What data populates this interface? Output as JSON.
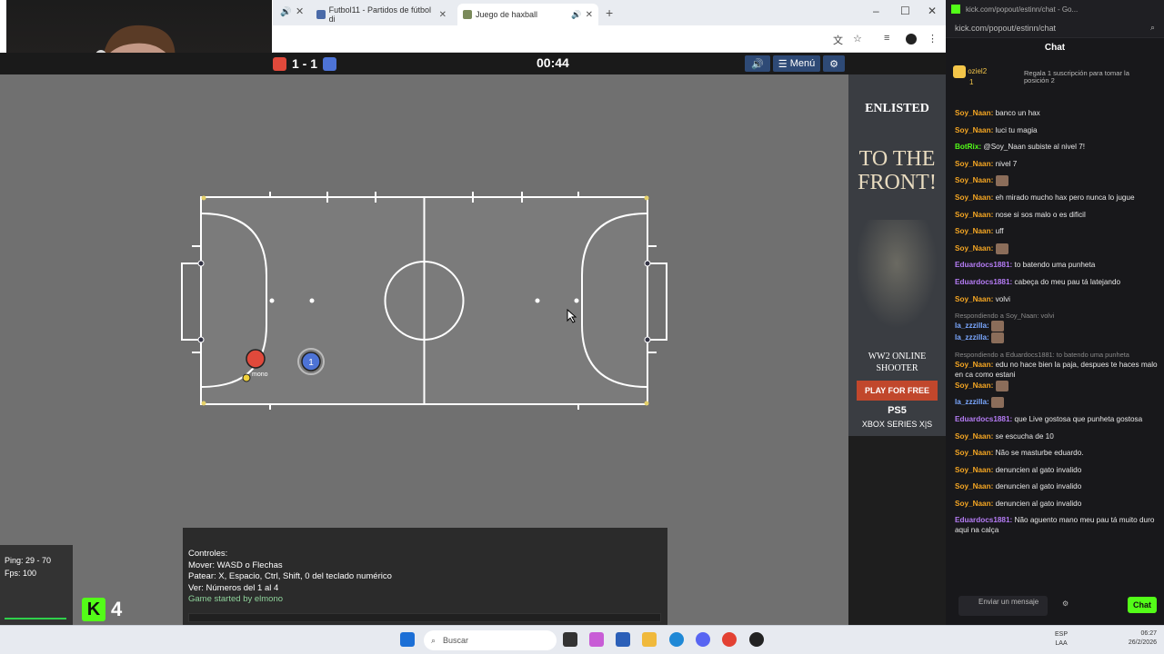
{
  "browser": {
    "tabs": [
      {
        "label": "Futbol11 - Partidos de fútbol di"
      },
      {
        "label": "Juego de haxball"
      }
    ],
    "new_tab": "+",
    "window_controls": {
      "minimize": "–",
      "maximize": "☐",
      "close": "✕"
    }
  },
  "game": {
    "score": "1 - 1",
    "timer": "00:44",
    "menu_label": "Menú",
    "player_label": "mono",
    "player_number": "1",
    "team_colors": {
      "red": "#e0493b",
      "blue": "#4d73d6"
    }
  },
  "controls": {
    "title": "Controles:",
    "move": "Mover: WASD o Flechas",
    "kick": "Patear: X, Espacio, Ctrl, Shift, 0 del teclado numérico",
    "view": "Ver: Números del 1 al 4",
    "started": "Game started by elmono"
  },
  "stats": {
    "ping": "Ping: 29 - 70",
    "fps": "Fps: 100"
  },
  "kick_badge": {
    "letter": "K",
    "count": "4"
  },
  "ad": {
    "logo": "ENLISTED",
    "headline": "TO THE FRONT!",
    "sub1": "WW2 ONLINE",
    "sub2": "SHOOTER",
    "cta": "PLAY FOR FREE",
    "platform1": "PS5",
    "platform2": "XBOX SERIES X|S"
  },
  "chat": {
    "url": "kick.com/popout/estinn/chat",
    "url_titlebar": "kick.com/popout/estinn/chat - Go...",
    "title": "Chat",
    "pinned_user": "oziel2",
    "pinned_count": "1",
    "pinned_msg": "Regala 1 suscripción para tomar la posición 2",
    "messages": [
      {
        "user": "Soy_Naan:",
        "text": "banco un hax",
        "color": "#f5a623"
      },
      {
        "user": "Soy_Naan:",
        "text": "luci tu magia",
        "color": "#f5a623"
      },
      {
        "user": "BotRix:",
        "text": "@Soy_Naan subiste al nivel 7!",
        "color": "#53fc18"
      },
      {
        "user": "Soy_Naan:",
        "text": "nivel 7",
        "color": "#f5a623"
      },
      {
        "user": "Soy_Naan:",
        "text": "",
        "color": "#f5a623"
      },
      {
        "user": "Soy_Naan:",
        "text": "eh mirado mucho hax pero nunca lo jugue",
        "color": "#f5a623"
      },
      {
        "user": "Soy_Naan:",
        "text": "nose si sos malo o es dificil",
        "color": "#f5a623"
      },
      {
        "user": "Soy_Naan:",
        "text": "uff",
        "color": "#f5a623"
      },
      {
        "user": "Soy_Naan:",
        "text": "",
        "color": "#f5a623"
      },
      {
        "user": "Eduardocs1881:",
        "text": "to batendo uma punheta",
        "color": "#b57cf5"
      },
      {
        "user": "Eduardocs1881:",
        "text": "cabeça do meu pau tá latejando",
        "color": "#b57cf5"
      },
      {
        "user": "Soy_Naan:",
        "text": "volvi",
        "color": "#f5a623"
      },
      {
        "reply": "Respondiendo a Soy_Naan: volvi",
        "user": "la_zzzilla:",
        "text": "",
        "color": "#7aa7ff"
      },
      {
        "user": "la_zzzilla:",
        "text": "",
        "color": "#7aa7ff"
      },
      {
        "reply": "Respondiendo a Eduardocs1881: to batendo uma punheta",
        "user": "Soy_Naan:",
        "text": "edu no hace bien la paja, despues te haces malo en ca como estani",
        "color": "#f5a623"
      },
      {
        "user": "Soy_Naan:",
        "text": "",
        "color": "#f5a623"
      },
      {
        "user": "la_zzzilla:",
        "text": "",
        "color": "#7aa7ff"
      },
      {
        "user": "Eduardocs1881:",
        "text": "que Live gostosa que punheta gostosa",
        "color": "#b57cf5"
      },
      {
        "user": "Soy_Naan:",
        "text": "se escucha de 10",
        "color": "#f5a623"
      },
      {
        "user": "Soy_Naan:",
        "text": "Não se masturbe eduardo.",
        "color": "#f5a623"
      },
      {
        "user": "Soy_Naan:",
        "text": "denuncien al gato invalido",
        "color": "#f5a623"
      },
      {
        "user": "Soy_Naan:",
        "text": "denuncien al gato invalido",
        "color": "#f5a623"
      },
      {
        "user": "Soy_Naan:",
        "text": "denuncien al gato invalido",
        "color": "#f5a623"
      },
      {
        "user": "Eduardocs1881:",
        "text": "Não aguento mano meu pau tá muito duro aqui na calça",
        "color": "#b57cf5"
      }
    ],
    "input_placeholder": "Enviar un mensaje",
    "send_label": "Chat"
  },
  "taskbar": {
    "search": "Buscar",
    "lang1": "ESP",
    "lang2": "LAA",
    "time": "06:27",
    "date": "26/2/2026"
  }
}
